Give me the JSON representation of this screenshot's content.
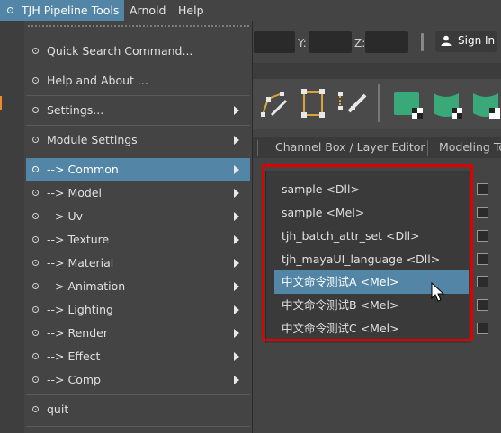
{
  "menubar": {
    "items": [
      {
        "id": "tjh",
        "label": "TJH Pipeline Tools"
      },
      {
        "id": "arnold",
        "label": "Arnold"
      },
      {
        "id": "help",
        "label": "Help"
      }
    ]
  },
  "statusline": {
    "y_label": "Y:",
    "z_label": "Z:",
    "sign_in": "Sign In"
  },
  "panel_tabs": [
    "Channel Box / Layer Editor",
    "Modeling To"
  ],
  "dropdown": {
    "items": [
      {
        "label": "Quick Search  Command...",
        "submenu": false
      },
      {
        "label": "Help and About ...",
        "submenu": false
      },
      {
        "label": "Settings...",
        "submenu": true
      },
      {
        "label": "Module Settings",
        "submenu": true
      },
      {
        "label": "--> Common",
        "submenu": true,
        "highlighted": true
      },
      {
        "label": "--> Model",
        "submenu": true
      },
      {
        "label": "--> Uv",
        "submenu": true
      },
      {
        "label": "--> Texture",
        "submenu": true
      },
      {
        "label": "--> Material",
        "submenu": true
      },
      {
        "label": "--> Animation",
        "submenu": true
      },
      {
        "label": "--> Lighting",
        "submenu": true
      },
      {
        "label": "--> Render",
        "submenu": true
      },
      {
        "label": "--> Effect",
        "submenu": true
      },
      {
        "label": "--> Comp",
        "submenu": true
      },
      {
        "label": "quit",
        "submenu": false
      }
    ]
  },
  "command_list": {
    "rows": [
      {
        "label": "sample  <Dll>",
        "selected": false
      },
      {
        "label": "sample  <Mel>",
        "selected": false
      },
      {
        "label": "tjh_batch_attr_set  <Dll>",
        "selected": false
      },
      {
        "label": "tjh_mayaUI_language  <Dll>",
        "selected": false
      },
      {
        "label": "中文命令测试A  <Mel>",
        "selected": true
      },
      {
        "label": "中文命令测试B  <Mel>",
        "selected": false
      },
      {
        "label": "中文命令测试C  <Mel>",
        "selected": false
      }
    ]
  },
  "colors": {
    "accent": "#5285a6",
    "annotation": "#e10000",
    "background": "#444444"
  }
}
